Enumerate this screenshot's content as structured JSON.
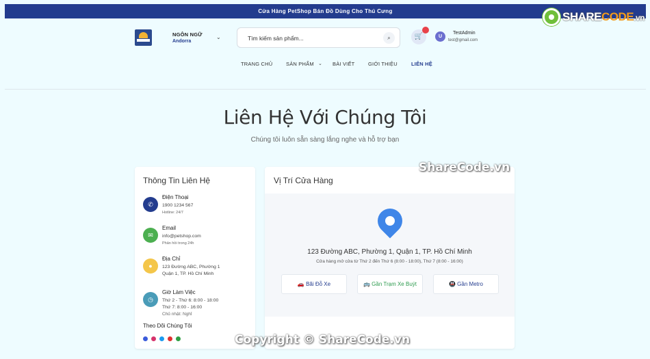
{
  "topbar": {
    "text": "Cửa Hàng PetShop Bán Đồ Dùng Cho Thú Cưng"
  },
  "brand": {
    "part1": "SHARE",
    "part2": "CODE",
    "suffix": ".vn",
    "icon": "sharecode-gear-icon"
  },
  "language": {
    "label": "NGÔN NGỮ",
    "value": "Andorra"
  },
  "search": {
    "placeholder": "Tìm kiếm sản phẩm..."
  },
  "user": {
    "initial": "U",
    "name": "TestAdmin",
    "email": "test@gmail.com"
  },
  "nav": {
    "items": [
      "TRANG CHỦ",
      "SẢN PHẨM",
      "BÀI VIẾT",
      "GIỚI THIỆU",
      "LIÊN HỆ"
    ],
    "active_index": 4
  },
  "hero": {
    "title": "Liên Hệ Với Chúng Tôi",
    "subtitle": "Chúng tôi luôn sẵn sàng lắng nghe và hỗ trợ bạn"
  },
  "contact": {
    "title": "Thông Tin Liên Hệ",
    "items": [
      {
        "title": "Điện Thoại",
        "value": "1900 1234 567",
        "note": "Hotline: 24/7",
        "icon": "phone-icon",
        "color": "#233c8e"
      },
      {
        "title": "Email",
        "value": "info@petshop.com",
        "note": "Phản hồi trong 24h",
        "icon": "email-icon",
        "color": "#4caf50"
      },
      {
        "title": "Địa Chỉ",
        "value": "123 Đường ABC, Phường 1",
        "value2": "Quận 1, TP. Hồ Chí Minh",
        "icon": "location-icon",
        "color": "#f4c64a"
      },
      {
        "title": "Giờ Làm Việc",
        "value": "Thứ 2 - Thứ 6: 8:00 - 18:00",
        "value2": "Thứ 7: 8:00 - 16:00",
        "note": "Chủ nhật: Nghỉ",
        "icon": "clock-icon",
        "color": "#4a9cb8"
      }
    ],
    "follow_label": "Theo Dõi Chúng Tôi",
    "socials": [
      {
        "name": "facebook-icon",
        "color": "#3b5bdb"
      },
      {
        "name": "instagram-icon",
        "color": "#d6336c"
      },
      {
        "name": "twitter-icon",
        "color": "#1c9bf0"
      },
      {
        "name": "youtube-icon",
        "color": "#e03131"
      },
      {
        "name": "whatsapp-icon",
        "color": "#2f9e44"
      }
    ]
  },
  "store": {
    "title": "Vị Trí Cửa Hàng",
    "address": "123 Đường ABC, Phường 1, Quận 1, TP. Hồ Chí Minh",
    "hours": "Cửa hàng mở cửa từ Thứ 2 đến Thứ 6 (8:00 - 18:00), Thứ 7 (8:00 - 16:00)",
    "chips": [
      "🚗 Bãi Đỗ Xe",
      "🚌 Gần Trạm Xe Buýt",
      "🚇 Gần Metro"
    ]
  },
  "watermark": {
    "side": "ShareCode.vn",
    "bottom": "Copyright © ShareCode.vn"
  }
}
